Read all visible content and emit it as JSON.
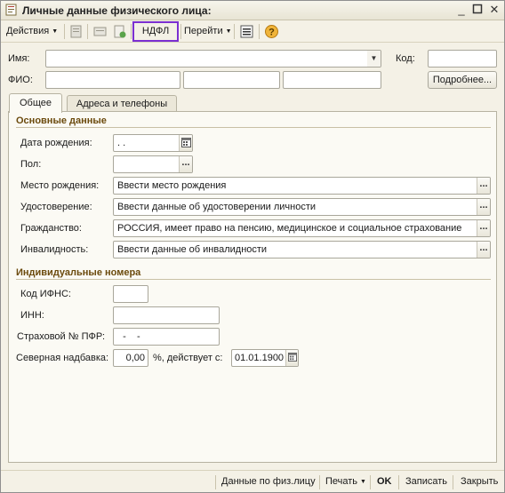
{
  "window": {
    "title": "Личные данные физического лица:"
  },
  "toolbar": {
    "actions_label": "Действия",
    "ndfl_label": "НДФЛ",
    "goto_label": "Перейти",
    "highlight_color": "#7b2fd1"
  },
  "header": {
    "name_label": "Имя:",
    "name_value": "",
    "code_label": "Код:",
    "code_value": "",
    "fio_label": "ФИО:",
    "details_button": "Подробнее..."
  },
  "tabs": [
    {
      "label": "Общее",
      "active": true
    },
    {
      "label": "Адреса и телефоны",
      "active": false
    }
  ],
  "basic": {
    "section_title": "Основные данные",
    "birth_date_label": "Дата рождения:",
    "birth_date_value": " .  .",
    "gender_label": "Пол:",
    "gender_value": "",
    "birthplace_label": "Место рождения:",
    "birthplace_value": "Ввести место рождения",
    "id_doc_label": "Удостоверение:",
    "id_doc_value": "Ввести данные об удостоверении личности",
    "citizenship_label": "Гражданство:",
    "citizenship_value": "РОССИЯ, имеет право на пенсию, медицинское и социальное страхование",
    "disability_label": "Инвалидность:",
    "disability_value": "Ввести данные об инвалидности"
  },
  "numbers": {
    "section_title": "Индивидуальные номера",
    "ifns_label": "Код ИФНС:",
    "ifns_value": "",
    "inn_label": "ИНН:",
    "inn_value": "",
    "pfr_label": "Страховой № ПФР:",
    "pfr_value": "  -    -",
    "north_label": "Северная надбавка:",
    "north_value": "0,00",
    "percent_label": "%, действует с:",
    "north_date_value": "01.01.1900"
  },
  "footer": {
    "data_by_person": "Данные по физ.лицу",
    "print_label": "Печать",
    "ok_label": "OK",
    "save_label": "Записать",
    "close_label": "Закрыть"
  }
}
